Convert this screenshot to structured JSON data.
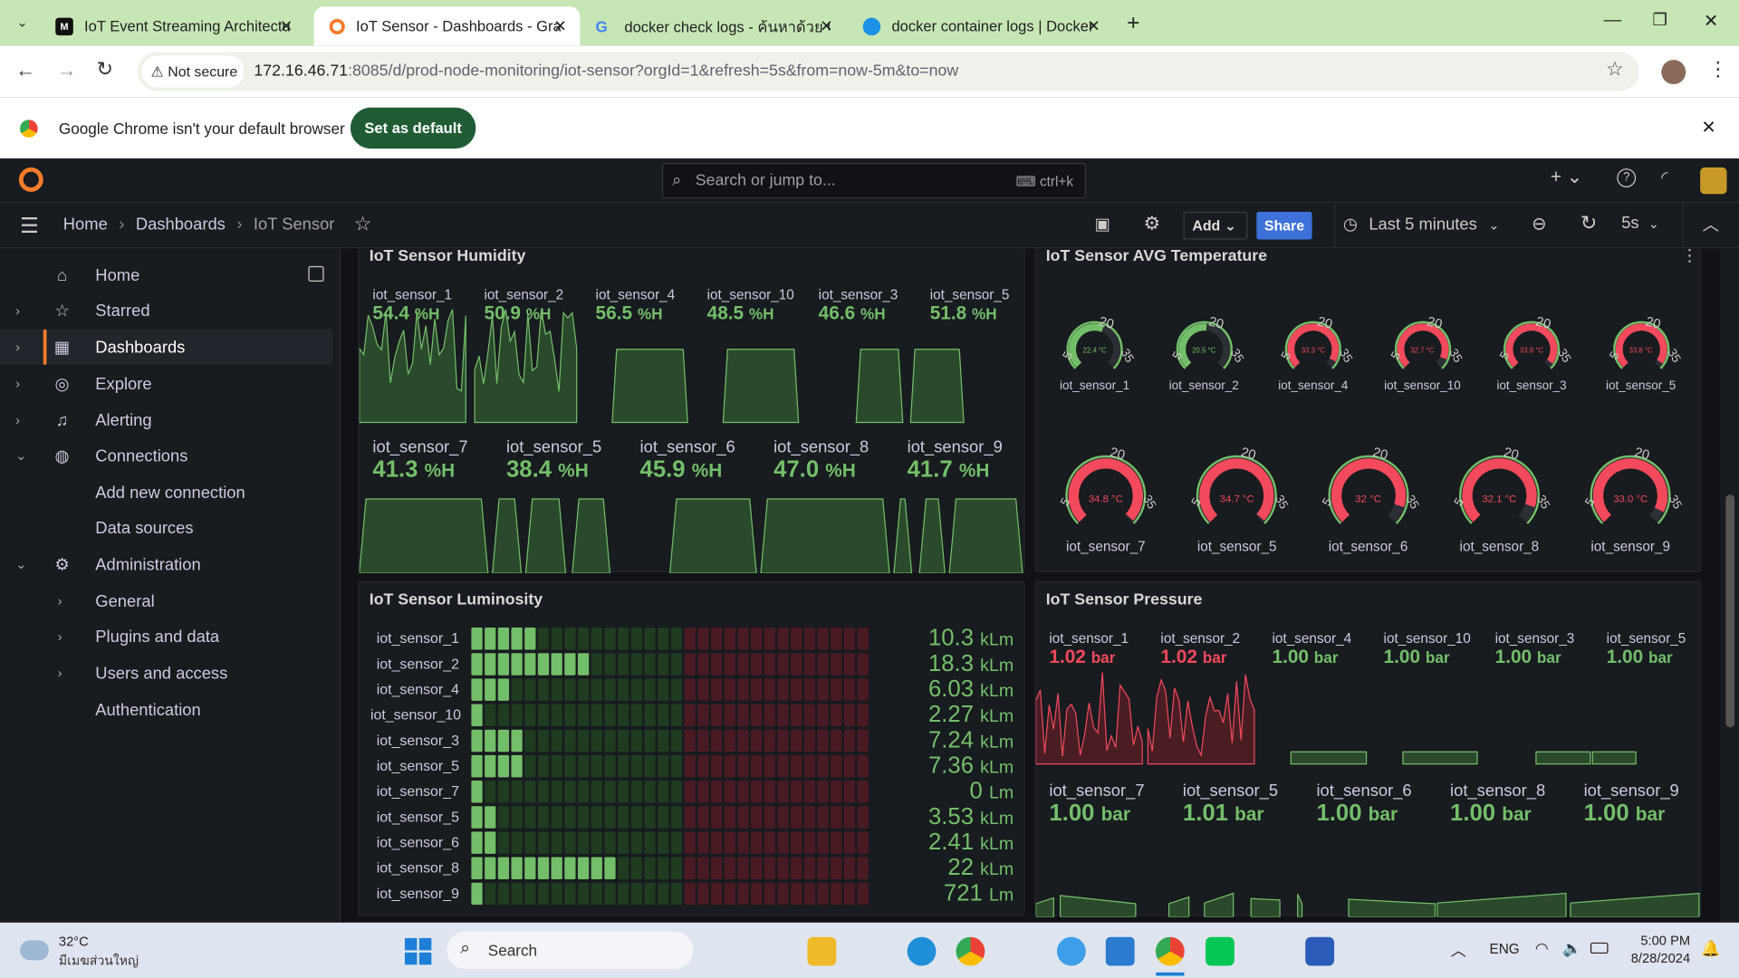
{
  "browser": {
    "tabs": [
      {
        "title": "IoT Event Streaming Architectur",
        "favicon": "medium-icon"
      },
      {
        "title": "IoT Sensor - Dashboards - Grafa",
        "favicon": "grafana-icon"
      },
      {
        "title": "docker check logs - ค้นหาด้วย Go",
        "favicon": "google-icon"
      },
      {
        "title": "docker container logs | Docker",
        "favicon": "docker-icon"
      }
    ],
    "security": "Not secure",
    "url_host": "172.16.46.71",
    "url_rest": ":8085/d/prod-node-monitoring/iot-sensor?orgId=1&refresh=5s&from=now-5m&to=now",
    "infobar_text": "Google Chrome isn't your default browser",
    "infobar_button": "Set as default"
  },
  "grafana": {
    "search_placeholder": "Search or jump to...",
    "search_shortcut": "ctrl+k",
    "breadcrumb": [
      "Home",
      "Dashboards",
      "IoT Sensor"
    ],
    "toolbar": {
      "add": "Add",
      "share": "Share",
      "time_range": "Last 5 minutes",
      "refresh": "5s"
    },
    "sidebar": [
      {
        "label": "Home",
        "icon": "home-icon",
        "level": 0,
        "chevron": ""
      },
      {
        "label": "Starred",
        "icon": "star-icon",
        "level": 0,
        "chevron": "›"
      },
      {
        "label": "Dashboards",
        "icon": "dashboards-icon",
        "level": 0,
        "chevron": "›",
        "active": true
      },
      {
        "label": "Explore",
        "icon": "compass-icon",
        "level": 0,
        "chevron": "›"
      },
      {
        "label": "Alerting",
        "icon": "bell-icon",
        "level": 0,
        "chevron": "›"
      },
      {
        "label": "Connections",
        "icon": "connections-icon",
        "level": 0,
        "chevron": "⌄"
      },
      {
        "label": "Add new connection",
        "icon": "",
        "level": 1,
        "chevron": ""
      },
      {
        "label": "Data sources",
        "icon": "",
        "level": 1,
        "chevron": ""
      },
      {
        "label": "Administration",
        "icon": "gear-icon",
        "level": 0,
        "chevron": "⌄"
      },
      {
        "label": "General",
        "icon": "",
        "level": 1,
        "chevron": "›"
      },
      {
        "label": "Plugins and data",
        "icon": "",
        "level": 1,
        "chevron": "›"
      },
      {
        "label": "Users and access",
        "icon": "",
        "level": 1,
        "chevron": "›"
      },
      {
        "label": "Authentication",
        "icon": "",
        "level": 1,
        "chevron": ""
      }
    ],
    "panels": {
      "humidity": {
        "title": "IoT Sensor Humidity",
        "row1": [
          {
            "name": "iot_sensor_1",
            "value": "54.4",
            "unit": "%H"
          },
          {
            "name": "iot_sensor_2",
            "value": "50.9",
            "unit": "%H"
          },
          {
            "name": "iot_sensor_4",
            "value": "56.5",
            "unit": "%H"
          },
          {
            "name": "iot_sensor_10",
            "value": "48.5",
            "unit": "%H"
          },
          {
            "name": "iot_sensor_3",
            "value": "46.6",
            "unit": "%H"
          },
          {
            "name": "iot_sensor_5",
            "value": "51.8",
            "unit": "%H"
          }
        ],
        "row2": [
          {
            "name": "iot_sensor_7",
            "value": "41.3",
            "unit": "%H"
          },
          {
            "name": "iot_sensor_5",
            "value": "38.4",
            "unit": "%H"
          },
          {
            "name": "iot_sensor_6",
            "value": "45.9",
            "unit": "%H"
          },
          {
            "name": "iot_sensor_8",
            "value": "47.0",
            "unit": "%H"
          },
          {
            "name": "iot_sensor_9",
            "value": "41.7",
            "unit": "%H"
          }
        ]
      },
      "temperature": {
        "title": "IoT Sensor AVG Temperature",
        "gauge_min": "5",
        "gauge_mid": "20",
        "gauge_max": "35",
        "row1": [
          {
            "name": "iot_sensor_1",
            "value": "22.4 °C",
            "fraction": 0.58,
            "color": "#73bf69"
          },
          {
            "name": "iot_sensor_2",
            "value": "20.5 °C",
            "fraction": 0.52,
            "color": "#73bf69"
          },
          {
            "name": "iot_sensor_4",
            "value": "33.3 °C",
            "fraction": 0.94,
            "color": "#f2495c"
          },
          {
            "name": "iot_sensor_10",
            "value": "32.7 °C",
            "fraction": 0.92,
            "color": "#f2495c"
          },
          {
            "name": "iot_sensor_3",
            "value": "33.9 °C",
            "fraction": 0.96,
            "color": "#f2495c"
          },
          {
            "name": "iot_sensor_5",
            "value": "33.8 °C",
            "fraction": 0.96,
            "color": "#f2495c"
          }
        ],
        "row2": [
          {
            "name": "iot_sensor_7",
            "value": "34.8 °C",
            "fraction": 0.99,
            "color": "#f2495c"
          },
          {
            "name": "iot_sensor_5",
            "value": "34.7 °C",
            "fraction": 0.99,
            "color": "#f2495c"
          },
          {
            "name": "iot_sensor_6",
            "value": "32 °C",
            "fraction": 0.9,
            "color": "#f2495c"
          },
          {
            "name": "iot_sensor_8",
            "value": "32.1 °C",
            "fraction": 0.9,
            "color": "#f2495c"
          },
          {
            "name": "iot_sensor_9",
            "value": "33.0 °C",
            "fraction": 0.93,
            "color": "#f2495c"
          }
        ]
      },
      "luminosity": {
        "title": "IoT Sensor Luminosity",
        "rows": [
          {
            "name": "iot_sensor_1",
            "value": "10.3",
            "unit": "kLm",
            "lit": 5
          },
          {
            "name": "iot_sensor_2",
            "value": "18.3",
            "unit": "kLm",
            "lit": 9
          },
          {
            "name": "iot_sensor_4",
            "value": "6.03",
            "unit": "kLm",
            "lit": 3
          },
          {
            "name": "iot_sensor_10",
            "value": "2.27",
            "unit": "kLm",
            "lit": 1
          },
          {
            "name": "iot_sensor_3",
            "value": "7.24",
            "unit": "kLm",
            "lit": 4
          },
          {
            "name": "iot_sensor_5",
            "value": "7.36",
            "unit": "kLm",
            "lit": 4
          },
          {
            "name": "iot_sensor_7",
            "value": "0",
            "unit": "Lm",
            "lit": 1
          },
          {
            "name": "iot_sensor_5",
            "value": "3.53",
            "unit": "kLm",
            "lit": 2
          },
          {
            "name": "iot_sensor_6",
            "value": "2.41",
            "unit": "kLm",
            "lit": 2
          },
          {
            "name": "iot_sensor_8",
            "value": "22",
            "unit": "kLm",
            "lit": 11
          },
          {
            "name": "iot_sensor_9",
            "value": "721",
            "unit": "Lm",
            "lit": 1
          }
        ]
      },
      "pressure": {
        "title": "IoT Sensor Pressure",
        "row1": [
          {
            "name": "iot_sensor_1",
            "value": "1.02",
            "unit": "bar",
            "status": "red"
          },
          {
            "name": "iot_sensor_2",
            "value": "1.02",
            "unit": "bar",
            "status": "red"
          },
          {
            "name": "iot_sensor_4",
            "value": "1.00",
            "unit": "bar",
            "status": "green"
          },
          {
            "name": "iot_sensor_10",
            "value": "1.00",
            "unit": "bar",
            "status": "green"
          },
          {
            "name": "iot_sensor_3",
            "value": "1.00",
            "unit": "bar",
            "status": "green"
          },
          {
            "name": "iot_sensor_5",
            "value": "1.00",
            "unit": "bar",
            "status": "green"
          }
        ],
        "row2": [
          {
            "name": "iot_sensor_7",
            "value": "1.00",
            "unit": "bar"
          },
          {
            "name": "iot_sensor_5",
            "value": "1.01",
            "unit": "bar"
          },
          {
            "name": "iot_sensor_6",
            "value": "1.00",
            "unit": "bar"
          },
          {
            "name": "iot_sensor_8",
            "value": "1.00",
            "unit": "bar"
          },
          {
            "name": "iot_sensor_9",
            "value": "1.00",
            "unit": "bar"
          }
        ]
      }
    }
  },
  "taskbar": {
    "weather_temp": "32°C",
    "weather_desc": "มีเมฆส่วนใหญ่",
    "search": "Search",
    "lang": "ENG",
    "time": "5:00 PM",
    "date": "8/28/2024"
  },
  "colors": {
    "green": "#73bf69",
    "red": "#f2495c",
    "share": "#3d71d9",
    "infobar_button": "#1f5c35"
  }
}
